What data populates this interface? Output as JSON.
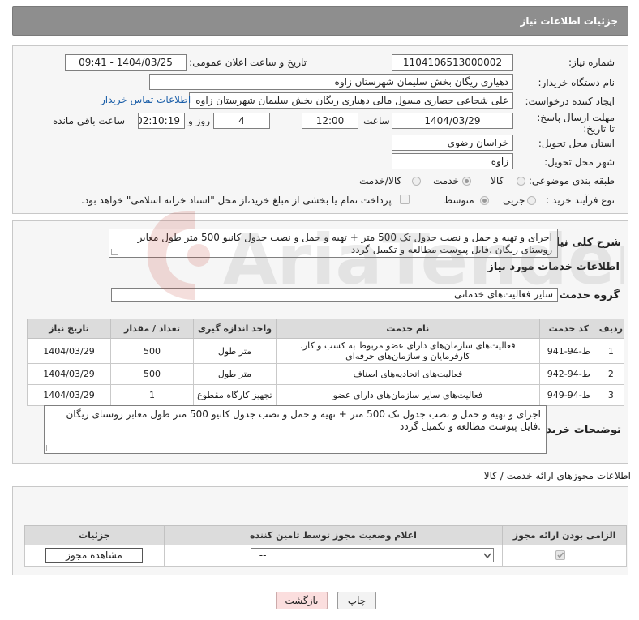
{
  "header": {
    "title": "جزئیات اطلاعات نیاز"
  },
  "form": {
    "need_number_label": "شماره نیاز:",
    "need_number": "1104106513000002",
    "announce_label": "تاریخ و ساعت اعلان عمومی:",
    "announce_value": "1404/03/25 - 09:41",
    "buyer_org_label": "نام دستگاه خریدار:",
    "buyer_org": "دهیاری ریگان بخش سلیمان شهرستان زاوه",
    "creator_label": "ایجاد کننده درخواست:",
    "creator": "علی شجاعی حصاری مسول مالی  دهیاری ریگان بخش سلیمان شهرستان زاوه",
    "contact_link": "اطلاعات تماس خریدار",
    "deadline_label": "مهلت ارسال پاسخ: تا تاریخ:",
    "deadline_date": "1404/03/29",
    "time_label": "ساعت",
    "deadline_time": "12:00",
    "days": "4",
    "days_label": "روز و",
    "remaining_time": "02:10:19",
    "remaining_label": "ساعت باقی مانده",
    "province_label": "استان محل تحویل:",
    "province": "خراسان رضوی",
    "city_label": "شهر محل تحویل:",
    "city": "زاوه",
    "category_label": "طبقه بندی موضوعی:",
    "category_options": [
      "کالا",
      "خدمت",
      "کالا/خدمت"
    ],
    "process_label": "نوع فرآیند خرید :",
    "process_options": [
      "جزیی",
      "متوسط"
    ],
    "payment_note": "پرداخت تمام یا بخشی از مبلغ خرید،از محل \"اسناد خزانه اسلامی\" خواهد بود."
  },
  "summary": {
    "label": "شرح کلی نیاز:",
    "text": "اجرای و تهیه و حمل و نصب  جدول تک 500 متر + تهیه و حمل و نصب جدول کانیو 500 متر طول معابر روستای ریگان .فایل پیوست مطالعه و تکمیل گردد",
    "services_title": "اطلاعات خدمات مورد نیاز",
    "group_label": "گروه خدمت:",
    "group_value": "سایر فعالیت‌های خدماتی"
  },
  "services_table": {
    "headers": [
      "ردیف",
      "کد خدمت",
      "نام خدمت",
      "واحد اندازه گیری",
      "تعداد / مقدار",
      "تاریخ نیاز"
    ],
    "rows": [
      [
        "1",
        "ط-94-941",
        "فعالیت‌های سازمان‌های دارای عضو مربوط به کسب و کار، کارفرمایان و سازمان‌های حرفه‌ای",
        "متر طول",
        "500",
        "1404/03/29"
      ],
      [
        "2",
        "ط-94-942",
        "فعالیت‌های اتحادیه‌های اصناف",
        "متر طول",
        "500",
        "1404/03/29"
      ],
      [
        "3",
        "ط-94-949",
        "فعالیت‌های سایر سازمان‌های دارای عضو",
        "تجهیز کارگاه مقطوع",
        "1",
        "1404/03/29"
      ]
    ]
  },
  "buyer_notes": {
    "label": "توضیحات خریدار:",
    "text": "اجرای و تهیه و حمل و نصب  جدول تک 500 متر + تهیه و حمل و نصب جدول کانیو 500 متر طول معابر روستای ریگان .فایل پیوست مطالعه و تکمیل گردد"
  },
  "permits": {
    "title": "اطلاعات مجوزهای ارائه خدمت / کالا",
    "headers": [
      "الزامی بودن ارائه مجوز",
      "اعلام وضعیت مجوز توسط تامین کننده",
      "جزئیات"
    ],
    "select_value": "--",
    "view_button": "مشاهده مجوز"
  },
  "footer": {
    "print": "چاپ",
    "back": "بازگشت"
  },
  "watermark": {
    "text": "AriaTender.neT"
  }
}
